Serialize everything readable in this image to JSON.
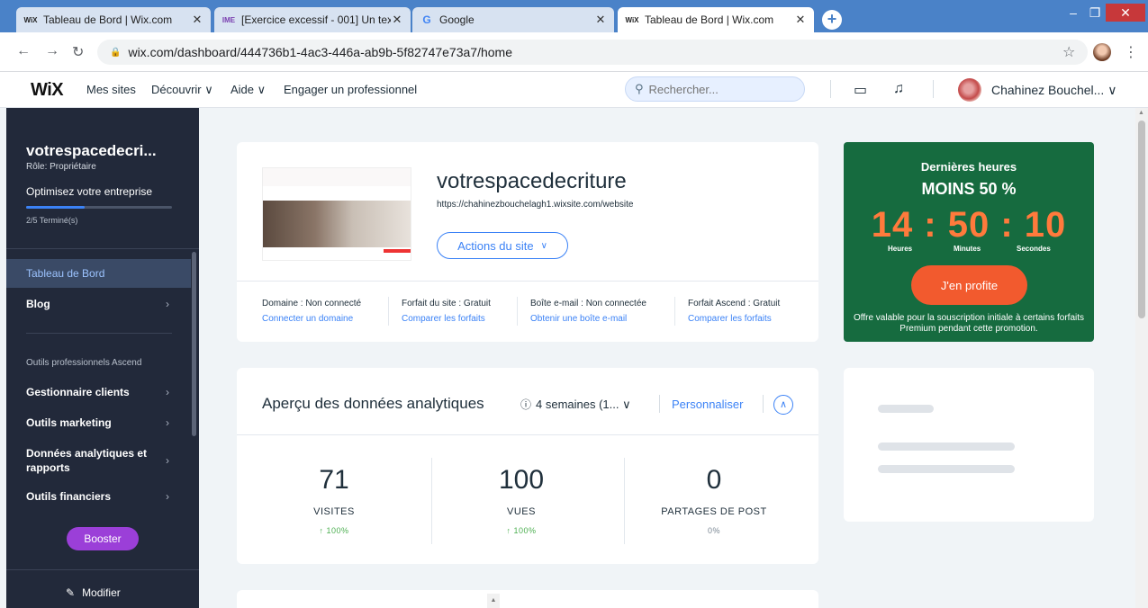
{
  "browser": {
    "tabs": [
      {
        "favicon": "WiX",
        "title": "Tableau de Bord | Wix.com"
      },
      {
        "favicon": "IME",
        "title": "[Exercice excessif - 001] Un texte"
      },
      {
        "favicon": "G",
        "title": "Google"
      },
      {
        "favicon": "WiX",
        "title": "Tableau de Bord | Wix.com"
      }
    ],
    "url": "wix.com/dashboard/444736b1-4ac3-446a-ab9b-5f82747e73a7/home"
  },
  "topbar": {
    "logo": "WiX",
    "nav": [
      "Mes sites",
      "Découvrir ∨",
      "Aide ∨",
      "Engager un professionnel"
    ],
    "search_placeholder": "Rechercher...",
    "user_name": "Chahinez Bouchel... ∨"
  },
  "sidebar": {
    "site_name": "votrespacedecri...",
    "role": "Rôle: Propriétaire",
    "optimize": "Optimisez votre entreprise",
    "progress_fraction": 0.4,
    "progress_text": "2/5 Terminé(s)",
    "items_top": [
      {
        "label": "Tableau de Bord",
        "active": true
      },
      {
        "label": "Blog",
        "active": false
      }
    ],
    "section_heading": "Outils professionnels Ascend",
    "items_tools": [
      {
        "label": "Gestionnaire clients"
      },
      {
        "label": "Outils marketing"
      },
      {
        "label": "Données analytiques et rapports"
      },
      {
        "label": "Outils financiers"
      }
    ],
    "booster": "Booster",
    "modifier": "Modifier"
  },
  "site_card": {
    "name": "votrespacedecriture",
    "url": "https://chahinezbouchelagh1.wixsite.com/website",
    "actions": "Actions du site",
    "meta": [
      {
        "label": "Domaine : Non connecté",
        "link": "Connecter un domaine"
      },
      {
        "label": "Forfait du site : Gratuit",
        "link": "Comparer les forfaits"
      },
      {
        "label": "Boîte e-mail : Non connectée",
        "link": "Obtenir une boîte e-mail"
      },
      {
        "label": "Forfait Ascend : Gratuit",
        "link": "Comparer les forfaits"
      }
    ]
  },
  "promo": {
    "line1": "Dernières heures",
    "line2": "MOINS 50 %",
    "timer": "14 : 50 : 10",
    "labels": [
      "Heures",
      "Minutes",
      "Secondes"
    ],
    "cta": "J'en profite",
    "note": "Offre valable pour la souscription initiale à certains forfaits Premium pendant cette promotion."
  },
  "analytics": {
    "title": "Aperçu des données analytiques",
    "range": "4 semaines (1... ∨",
    "customize": "Personnaliser",
    "stats": [
      {
        "value": "71",
        "label": "VISITES",
        "change": "↑ 100%",
        "change_color": "#4caf50"
      },
      {
        "value": "100",
        "label": "VUES",
        "change": "↑ 100%",
        "change_color": "#4caf50"
      },
      {
        "value": "0",
        "label": "PARTAGES DE POST",
        "change": "0%",
        "change_color": "#7a8793"
      }
    ]
  }
}
